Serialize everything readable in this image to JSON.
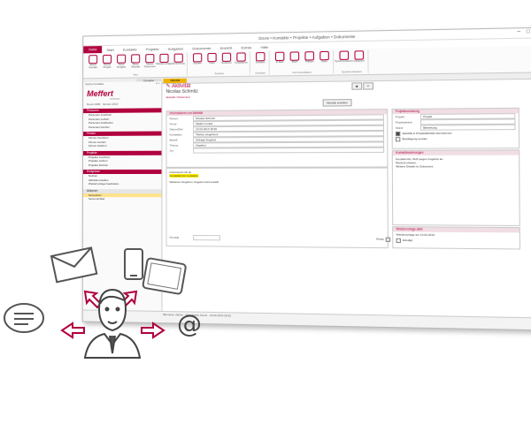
{
  "window": {
    "title": "Dovis • Kontakte • Projekte • Aufgaben • Dokumente"
  },
  "menu": {
    "file": "Datei",
    "items": [
      "Start",
      "Kontakte",
      "Projekte",
      "Aufgaben",
      "Dokumente",
      "Ansicht",
      "Extras",
      "Hilfe"
    ]
  },
  "ribbon": [
    {
      "label": "Neu",
      "buttons": [
        "Neuer Kontakt",
        "Neues Projekt",
        "Neue Aufgabe",
        "Neue Aktivität",
        "Neues Dokument",
        "Wiedervorlage",
        "Erinnerung"
      ]
    },
    {
      "label": "Suchen",
      "buttons": [
        "Suchen",
        "Filter",
        "Sortieren",
        "Gruppieren"
      ]
    },
    {
      "label": "Drucken",
      "buttons": [
        "Drucken"
      ]
    },
    {
      "label": "Kommunikation",
      "buttons": [
        "E-Mail",
        "Brief",
        "Telefon",
        "Notiz"
      ]
    },
    {
      "label": "Synchronisation",
      "buttons": [
        "Synchronisieren",
        "Optionen"
      ]
    }
  ],
  "tabs": [
    "Kontakte",
    "Aktivität"
  ],
  "sidebar": {
    "header": "Suche Kontakte",
    "logo": "Meffert",
    "logo_sub": "Software",
    "meta": "Dovis CRM · Version 2013",
    "sections": [
      {
        "title": "Personen",
        "items": [
          "Personen zuordnen",
          "Personen suchen",
          "Personen bearbeiten",
          "Personen löschen"
        ]
      },
      {
        "title": "Firmen",
        "items": [
          "Firmen zuordnen",
          "Firmen suchen",
          "Firmen löschen"
        ]
      },
      {
        "title": "Projekte",
        "items": [
          "Projekte zuordnen",
          "Projekte suchen",
          "Projekte löschen"
        ]
      },
      {
        "title": "Ereignisse",
        "items": [
          "Notizen",
          "Aktivität erstellen",
          "Wiedervorlage bearbeiten"
        ]
      },
      {
        "title": "Aktionen",
        "items": [
          "Serienbrief",
          "Serien-E-Mail"
        ]
      }
    ],
    "highlight": "Serienbrief"
  },
  "form": {
    "title": "Aktivität",
    "subject": "Nicolas Schmitz",
    "crumb": "Aktivität / Dokument",
    "button": "Aktivität erstellen",
    "info_header": "Informationen zur Aktivität",
    "fields": [
      {
        "k": "Person",
        "v": "Nicolas Schmitz"
      },
      {
        "k": "Firma",
        "v": "Meffert GmbH"
      },
      {
        "k": "Datum/Zeit",
        "v": "13.03.2013   18:30"
      },
      {
        "k": "Kontaktart",
        "v": "Telefon eingehend"
      },
      {
        "k": "Betreff",
        "v": "Anfrage Angebot"
      },
      {
        "k": "Thema",
        "v": "Angebot"
      },
      {
        "k": "Ort",
        "v": ""
      }
    ],
    "body_lines": [
      "Interessent ruft an",
      "Kontaktart ist zu ändern",
      "Weiteres Vorgehen: Angebot wird erstellt"
    ],
    "priority_label": "Priorität",
    "private_label": "Privat",
    "project_header": "Projektzuordnung",
    "project_fields": [
      {
        "k": "Projekt",
        "v": "Projekt"
      },
      {
        "k": "Projektphase",
        "v": ""
      },
      {
        "k": "Stand",
        "v": "Bewertung"
      }
    ],
    "checks": [
      "Aktivität in Projektaktivität übernehmen",
      "Bestätigung senden"
    ],
    "contact_header": "Kontaktbeziehungen",
    "contact_text": [
      "Kontakt-Info: Ruft wegen Angebot an.",
      "Rückruf erbeten.",
      "Weitere Details im Dokument."
    ],
    "resub_header": "Wiedervorlage aktiv",
    "resub_fields": [
      "Wiedervorlage am 14.03.2013",
      "Erledigt"
    ]
  },
  "status": {
    "text": "Benutzer: Admin · Datenbank: Dovis · 13.03.2013 18:30"
  },
  "overlay": {
    "at_symbol": "@"
  }
}
